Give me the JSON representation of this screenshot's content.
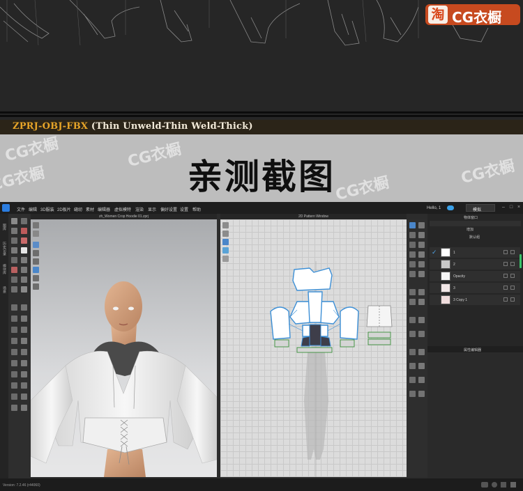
{
  "banner": {
    "format_prefix": "ZPRJ-OBJ-FBX",
    "format_suffix": " (Thin Unweld-Thin Weld-Thick)",
    "brand_logo_char": "淘",
    "brand_text": "CG衣橱"
  },
  "title_band": {
    "title": "亲测截图",
    "watermarks": [
      "CG衣橱",
      "CG衣橱",
      "CG衣橱",
      "CG衣橱",
      "CG衣橱"
    ]
  },
  "app": {
    "menu": [
      "文件",
      "编辑",
      "3D服装",
      "2D板片",
      "缝纫",
      "素材",
      "编辑器",
      "虚拟模特",
      "渲染",
      "显示",
      "偏好设置",
      "设置",
      "帮助"
    ],
    "user_label": "Hello, 1",
    "mode_label": "模拟",
    "left_tabs": [
      "图库",
      "历史记录",
      "模块库",
      "场景"
    ],
    "viewport_3d_title": "zh_Women Crop Hoodie 01.zprj",
    "pattern_window_title": "2D Pattern Window",
    "right_panel": {
      "title": "物体窗口",
      "add_label": "增加",
      "default_label": "默认组",
      "layers": [
        {
          "name": "1",
          "color": "#ffffff"
        },
        {
          "name": "2",
          "color": "#c9c9c9"
        },
        {
          "name": "Opacity",
          "color": "#f5f5f5"
        },
        {
          "name": "3",
          "color": "#f2e7e7"
        },
        {
          "name": "3 Copy 1",
          "color": "#efdcdc"
        }
      ]
    },
    "property_panel_title": "属性编辑器",
    "version": "Version: 7.2.46 (r44060)"
  },
  "colors": {
    "banner_bg": "#262626",
    "format_accent": "#e6a428",
    "brand_bg": "#c74a1f",
    "title_band_bg": "#bdbdbd",
    "app_accent": "#2b7de0"
  }
}
